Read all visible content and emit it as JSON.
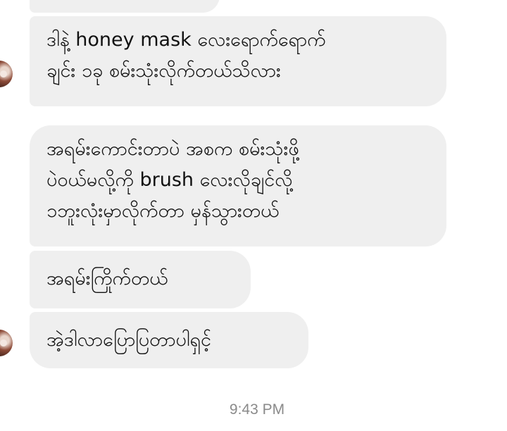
{
  "conversation": {
    "messages": [
      {
        "lines": [
          ""
        ]
      },
      {
        "lines": [
          "ဒါနဲ့ honey mask လေးရောက်ရောက်",
          "ချင်း ၁ခု စမ်းသုံးလိုက်တယ်သိလား"
        ]
      },
      {
        "lines": [
          "အရမ်းကောင်းတာပဲ အစက စမ်းသုံးဖို့",
          "ပဲဝယ်မလို့ကို brush လေးလိုချင်လို့",
          "၁ဘူးလုံးမှာလိုက်တာ မှန်သွားတယ်"
        ]
      },
      {
        "lines": [
          "အရမ်းကြိုက်တယ်"
        ]
      },
      {
        "lines": [
          "အဲ့ဒါလာပြောပြတာပါရှင့်"
        ]
      }
    ],
    "timestamp": "9:43 PM"
  },
  "colors": {
    "bubble_background": "#efefef",
    "text": "#111111",
    "timestamp_text": "#8a8a8a",
    "page_background": "#ffffff"
  },
  "icons": {
    "sender_avatar": "profile-photo"
  }
}
